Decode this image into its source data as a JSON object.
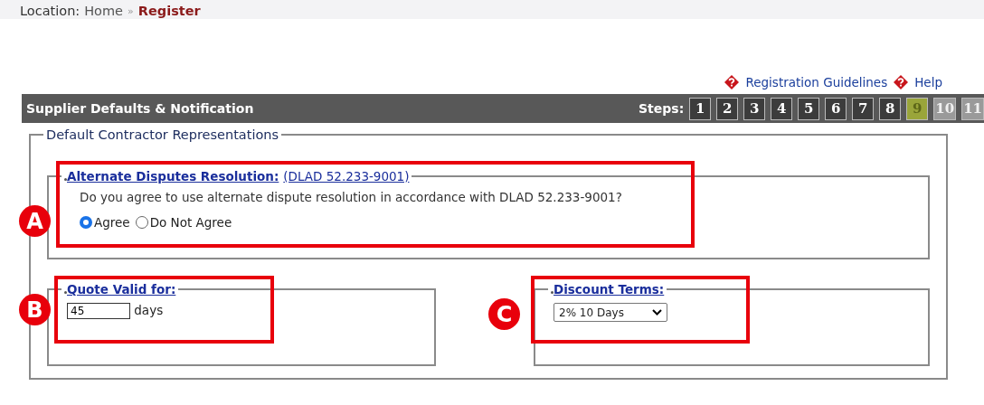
{
  "location": {
    "label": "Location:",
    "crumbs": [
      {
        "text": "Home",
        "current": false
      },
      {
        "text": "Register",
        "current": true
      }
    ],
    "separator": "»"
  },
  "help_links": [
    "Registration Guidelines",
    "Help"
  ],
  "header": {
    "title": "Supplier Defaults & Notification",
    "steps_label": "Steps:",
    "steps": [
      {
        "label": "1",
        "selected": false,
        "completed": true
      },
      {
        "label": "2",
        "selected": false,
        "completed": true
      },
      {
        "label": "3",
        "selected": false,
        "completed": true
      },
      {
        "label": "4",
        "selected": false,
        "completed": true
      },
      {
        "label": "5",
        "selected": false,
        "completed": true
      },
      {
        "label": "6",
        "selected": false,
        "completed": true
      },
      {
        "label": "7",
        "selected": false,
        "completed": true
      },
      {
        "label": "8",
        "selected": false,
        "completed": true
      },
      {
        "label": "9",
        "selected": true,
        "completed": false
      },
      {
        "label": "10",
        "selected": false,
        "completed": false
      },
      {
        "label": "11",
        "selected": false,
        "completed": false
      }
    ]
  },
  "section": {
    "legend": "Default Contractor Representations",
    "disputes": {
      "legend": "Alternate Disputes Resolution:",
      "reference": "(DLAD 52.233-9001)",
      "question": "Do you agree to use alternate dispute resolution in accordance with DLAD 52.233-9001?",
      "options": [
        {
          "label": "Agree",
          "selected": true
        },
        {
          "label": "Do Not Agree",
          "selected": false
        }
      ]
    },
    "quote": {
      "legend": "Quote Valid for:",
      "value": "45",
      "unit": "days"
    },
    "discount": {
      "legend": "Discount Terms:",
      "value": "2% 10 Days"
    }
  },
  "annotations": [
    {
      "label": "A"
    },
    {
      "label": "B"
    },
    {
      "label": "C"
    }
  ]
}
